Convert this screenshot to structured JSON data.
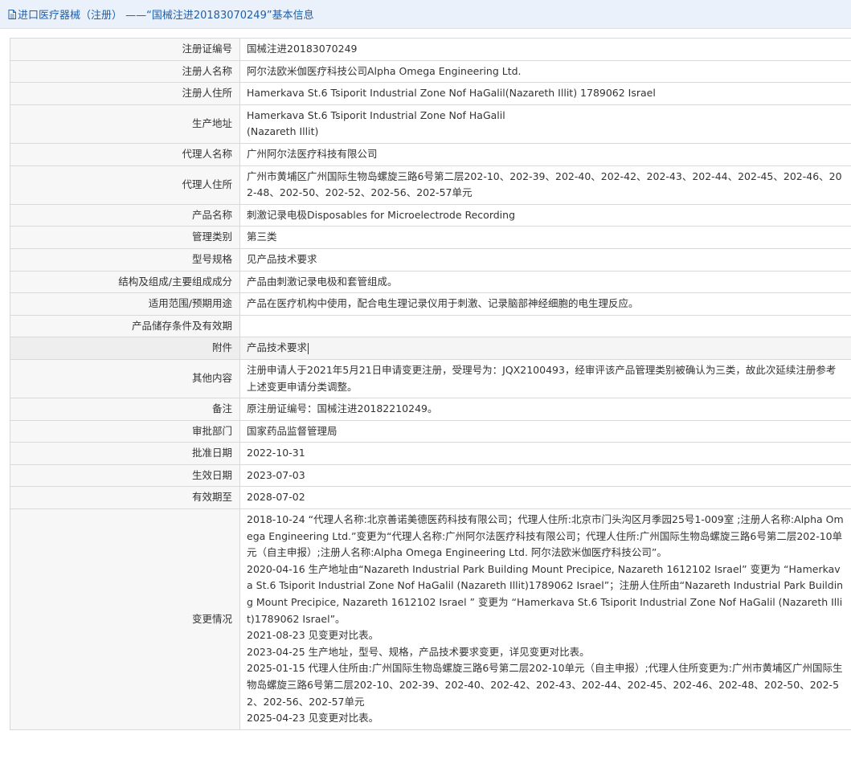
{
  "header": {
    "title": "进口医疗器械（注册） ——“国械注进20183070249”基本信息",
    "icon": "document-icon"
  },
  "rows": [
    {
      "label": "注册证编号",
      "value": "国械注进20183070249"
    },
    {
      "label": "注册人名称",
      "value": "阿尔法欧米伽医疗科技公司Alpha Omega Engineering Ltd."
    },
    {
      "label": "注册人住所",
      "value": "Hamerkava St.6 Tsiporit Industrial Zone Nof HaGalil(Nazareth Illit) 1789062 Israel"
    },
    {
      "label": "生产地址",
      "value_line1": "Hamerkava St.6 Tsiporit Industrial Zone Nof HaGalil",
      "value_line2": "(Nazareth Illit)"
    },
    {
      "label": "代理人名称",
      "value": "广州阿尔法医疗科技有限公司"
    },
    {
      "label": "代理人住所",
      "value": "广州市黄埔区广州国际生物岛螺旋三路6号第二层202-10、202-39、202-40、202-42、202-43、202-44、202-45、202-46、202-48、202-50、202-52、202-56、202-57单元"
    },
    {
      "label": "产品名称",
      "value": "刺激记录电极Disposables for Microelectrode Recording"
    },
    {
      "label": "管理类别",
      "value": "第三类"
    },
    {
      "label": "型号规格",
      "value": "见产品技术要求"
    },
    {
      "label": "结构及组成/主要组成成分",
      "value": "产品由刺激记录电极和套管组成。"
    },
    {
      "label": "适用范围/预期用途",
      "value": "产品在医疗机构中使用，配合电生理记录仪用于刺激、记录脑部神经细胞的电生理反应。"
    },
    {
      "label": "产品储存条件及有效期",
      "value": ""
    },
    {
      "label": "附件",
      "value": "产品技术要求"
    },
    {
      "label": "其他内容",
      "value": "注册申请人于2021年5月21日申请变更注册，受理号为：JQX2100493，经审评该产品管理类别被确认为三类，故此次延续注册参考上述变更申请分类调整。"
    },
    {
      "label": "备注",
      "value": "原注册证编号：国械注进20182210249。"
    },
    {
      "label": "审批部门",
      "value": "国家药品监督管理局"
    },
    {
      "label": "批准日期",
      "value": "2022-10-31"
    },
    {
      "label": "生效日期",
      "value": "2023-07-03"
    },
    {
      "label": "有效期至",
      "value": "2028-07-02"
    },
    {
      "label": "变更情况",
      "history": [
        "2018-10-24 “代理人名称:北京善诺美德医药科技有限公司；代理人住所:北京市门头沟区月季园25号1-009室 ;注册人名称:Alpha Omega Engineering Ltd.”变更为“代理人名称:广州阿尔法医疗科技有限公司；代理人住所:广州国际生物岛螺旋三路6号第二层202-10单元（自主申报）;注册人名称:Alpha Omega Engineering Ltd. 阿尔法欧米伽医疗科技公司”。",
        "2020-04-16 生产地址由“Nazareth Industrial Park Building Mount Precipice, Nazareth 1612102 Israel” 变更为 “Hamerkava St.6 Tsiporit Industrial Zone Nof HaGalil (Nazareth Illit)1789062 Israel”；注册人住所由“Nazareth Industrial Park Building Mount Precipice, Nazareth 1612102 Israel ” 变更为 “Hamerkava St.6 Tsiporit Industrial Zone Nof HaGalil (Nazareth Illit)1789062 Israel”。",
        "2021-08-23 见变更对比表。",
        "2023-04-25 生产地址，型号、规格，产品技术要求变更，详见变更对比表。",
        "2025-01-15 代理人住所由:广州国际生物岛螺旋三路6号第二层202-10单元（自主申报）;代理人住所变更为:广州市黄埔区广州国际生物岛螺旋三路6号第二层202-10、202-39、202-40、202-42、202-43、202-44、202-45、202-46、202-48、202-50、202-52、202-56、202-57单元",
        "2025-04-23 见变更对比表。"
      ]
    }
  ]
}
